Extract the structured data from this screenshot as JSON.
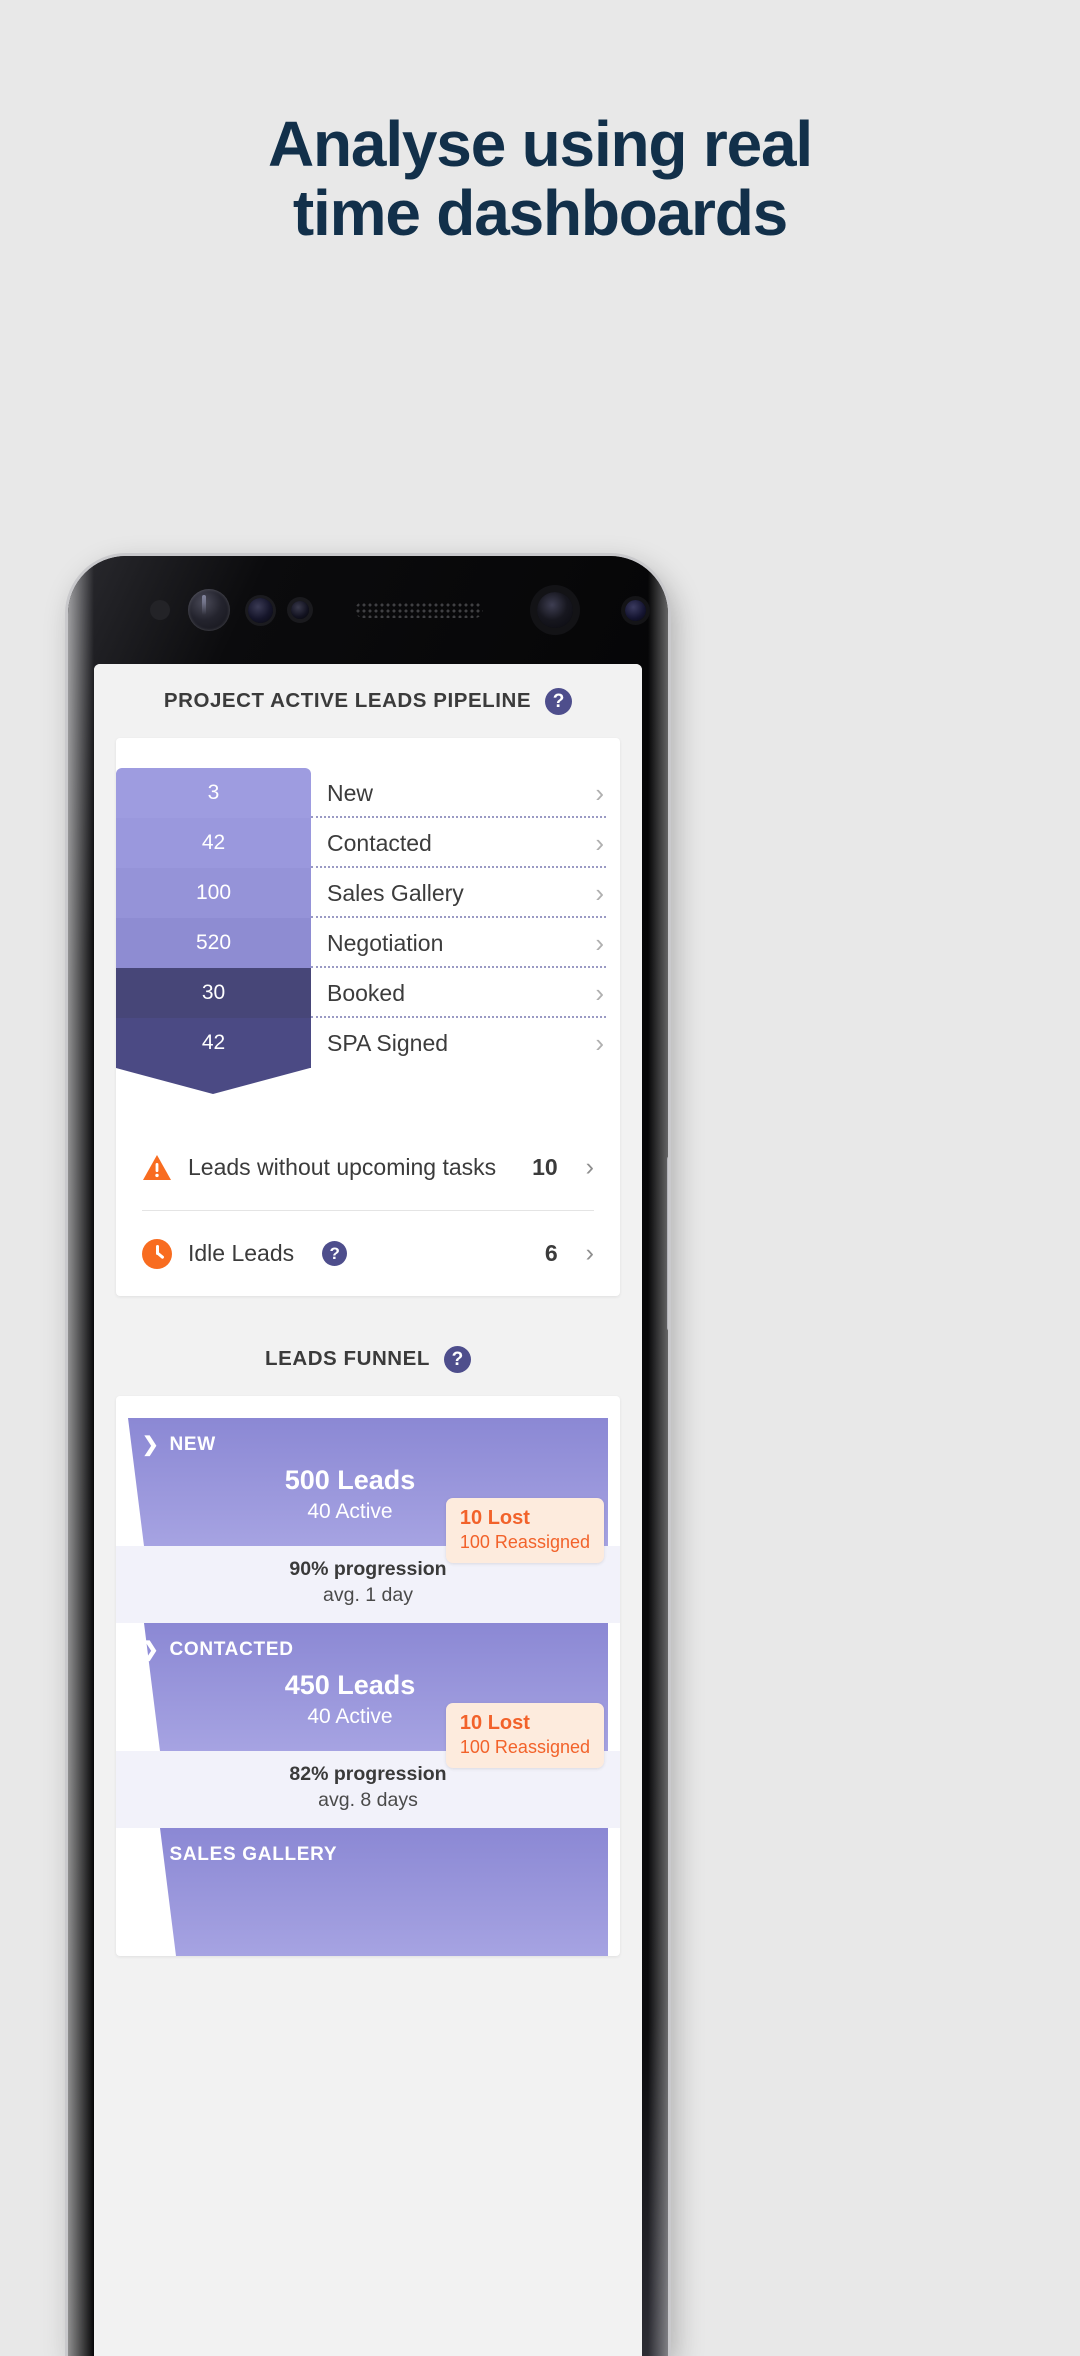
{
  "promo": {
    "line1": "Analyse using real",
    "line2": "time dashboards"
  },
  "colors": {
    "background": "#e8e8e8",
    "headline": "#12304a",
    "accent_purple": "#8d8ad6",
    "deep_purple": "#4b4a84",
    "help_badge": "#4e4e8c",
    "orange": "#f86c20",
    "lost_text": "#f2622a",
    "lost_bg": "#fdebdd"
  },
  "pipeline_section": {
    "title": "PROJECT ACTIVE LEADS PIPELINE",
    "help_icon": "question-mark-icon",
    "help_label": "?",
    "chevron": "›",
    "stages": [
      {
        "count": "3",
        "label": "New",
        "color": "#9e9ce0"
      },
      {
        "count": "42",
        "label": "Contacted",
        "color": "#9a98dd"
      },
      {
        "count": "100",
        "label": "Sales Gallery",
        "color": "#9593d8"
      },
      {
        "count": "520",
        "label": "Negotiation",
        "color": "#8e8cd2"
      },
      {
        "count": "30",
        "label": "Booked",
        "color": "#474678"
      },
      {
        "count": "42",
        "label": "SPA Signed",
        "color": "#4b4a84"
      }
    ],
    "alerts": [
      {
        "icon": "warning-triangle-icon",
        "label": "Leads without upcoming tasks",
        "value": "10",
        "has_help": false,
        "chevron": "›"
      },
      {
        "icon": "clock-icon",
        "label": "Idle Leads",
        "value": "6",
        "has_help": true,
        "help_label": "?",
        "chevron": "›"
      }
    ]
  },
  "funnel_section": {
    "title": "LEADS FUNNEL",
    "help_icon": "question-mark-icon",
    "help_label": "?",
    "stage_chevron": "❯",
    "stages": [
      {
        "name": "NEW",
        "leads": "500 Leads",
        "active": "40 Active",
        "progression": "90% progression",
        "avg": "avg. 1 day",
        "lost": "10 Lost",
        "reassigned": "100 Reassigned"
      },
      {
        "name": "CONTACTED",
        "leads": "450 Leads",
        "active": "40 Active",
        "progression": "82% progression",
        "avg": "avg. 8 days",
        "lost": "10 Lost",
        "reassigned": "100 Reassigned"
      },
      {
        "name": "SALES GALLERY",
        "leads": "",
        "active": "",
        "progression": "",
        "avg": "",
        "lost": "",
        "reassigned": ""
      }
    ]
  },
  "chart_data": {
    "type": "bar",
    "title": "PROJECT ACTIVE LEADS PIPELINE",
    "categories": [
      "New",
      "Contacted",
      "Sales Gallery",
      "Negotiation",
      "Booked",
      "SPA Signed"
    ],
    "values": [
      3,
      42,
      100,
      520,
      30,
      42
    ],
    "xlabel": "",
    "ylabel": "Leads",
    "legend": [],
    "grid": false,
    "notes": "Horizontal funnel bars, equal pixel width, value rendered inside bar"
  }
}
